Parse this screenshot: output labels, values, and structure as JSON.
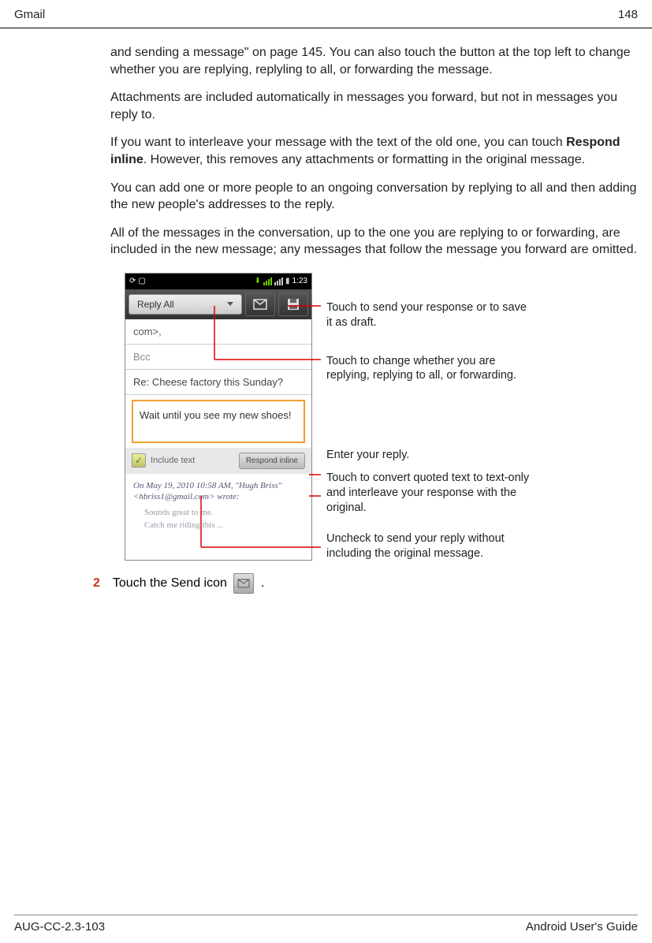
{
  "header": {
    "section": "Gmail",
    "page_number": "148"
  },
  "paragraphs": {
    "p1": "and sending a message\" on page 145. You can also touch the button at the top left to change whether you are replying, replyling to all, or forwarding the message.",
    "p2": "Attachments are included automatically in messages you forward, but not in messages you reply to.",
    "p3_pre": "If you want to interleave your message with the text of the old one, you can touch ",
    "p3_bold": "Respond inline",
    "p3_post": ". However, this removes any attachments or formatting in the original message.",
    "p4": "You can add one or more people to an ongoing conversation by replying to all and then adding the new people's addresses to the reply.",
    "p5": "All of the messages in the conversation, up to the one you are replying to or forwarding, are included in the new message; any messages that follow the message you forward are omitted."
  },
  "screenshot": {
    "status_time": "1:23",
    "reply_all": "Reply All",
    "to_field": "com>,",
    "bcc": "Bcc",
    "subject": "Re: Cheese factory this Sunday?",
    "compose_text": "Wait until you see my new shoes!",
    "include_text_label": "Include text",
    "respond_inline": "Respond inline",
    "quote_header": "On May 19, 2010 10:58 AM, \"Hugh Briss\" <hbriss1@gmail.com> wrote:",
    "quote_line1": "Sounds great to me.",
    "quote_line2": "Catch me riding this ..."
  },
  "callouts": {
    "c1": "Touch to send your response or to save it as draft.",
    "c2": "Touch to change whether you are replying, replying to all, or forwarding.",
    "c3": "Enter your reply.",
    "c4": "Touch to convert quoted text to text-only and interleave your response with the original.",
    "c5": "Uncheck to send your reply without including the original message."
  },
  "step": {
    "number": "2",
    "text_pre": "Touch the Send icon ",
    "text_post": " ."
  },
  "footer": {
    "left": "AUG-CC-2.3-103",
    "right": "Android User's Guide"
  }
}
